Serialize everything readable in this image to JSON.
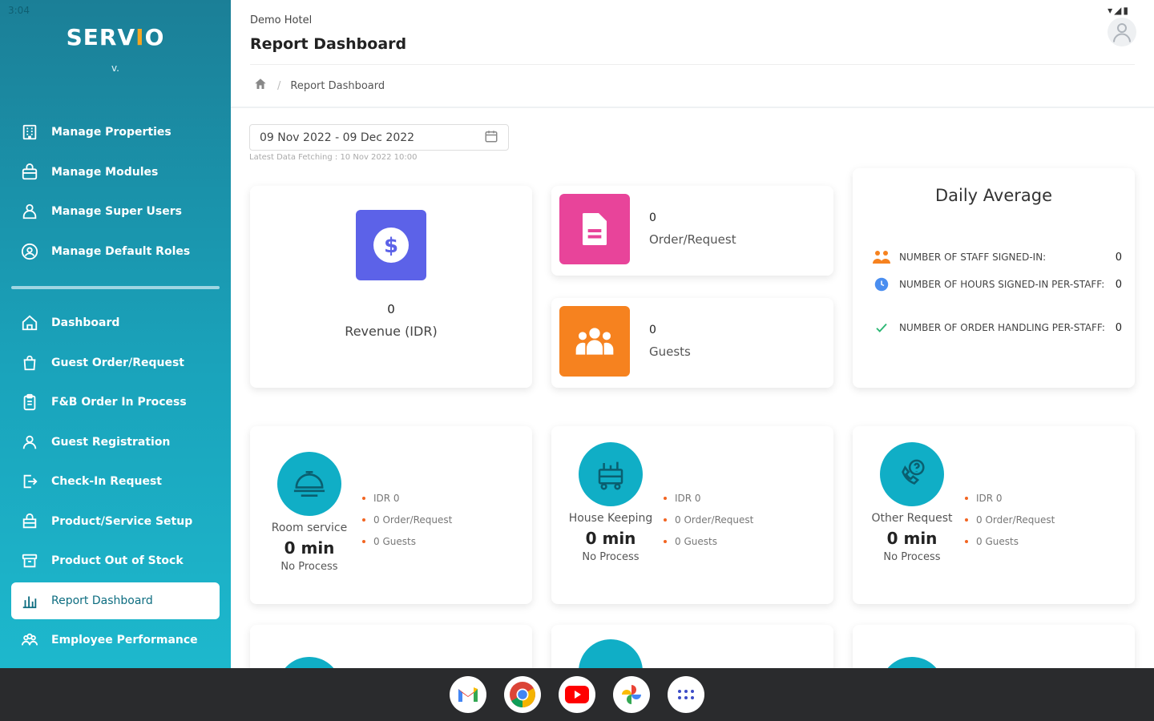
{
  "status": {
    "time": "3:04",
    "icons": "▾◢▮"
  },
  "sidebar": {
    "brand_pre": "SERV",
    "brand_accent": "I",
    "brand_post": "O",
    "brand_sub": "v.",
    "top_items": [
      {
        "label": "Manage Properties",
        "icon": "building-icon"
      },
      {
        "label": "Manage Modules",
        "icon": "briefcase-icon"
      },
      {
        "label": "Manage Super Users",
        "icon": "users-icon"
      },
      {
        "label": "Manage Default Roles",
        "icon": "role-icon"
      }
    ],
    "bottom_items": [
      {
        "label": "Dashboard",
        "icon": "home-icon"
      },
      {
        "label": "Guest Order/Request",
        "icon": "bag-icon"
      },
      {
        "label": "F&B Order In Process",
        "icon": "clipboard-icon"
      },
      {
        "label": "Guest Registration",
        "icon": "user-icon"
      },
      {
        "label": "Check-In Request",
        "icon": "checkin-icon"
      },
      {
        "label": "Product/Service Setup",
        "icon": "box-icon"
      },
      {
        "label": "Product Out of Stock",
        "icon": "archive-icon"
      },
      {
        "label": "Report Dashboard",
        "icon": "chart-icon",
        "active": true
      },
      {
        "label": "Employee Performance",
        "icon": "team-icon"
      }
    ]
  },
  "header": {
    "hotel": "Demo Hotel",
    "title": "Report Dashboard"
  },
  "breadcrumb": {
    "current": "Report Dashboard"
  },
  "filter": {
    "date_range": "09 Nov 2022 - 09 Dec 2022",
    "note": "Latest Data Fetching : 10 Nov 2022 10:00"
  },
  "revenue": {
    "value": "0",
    "label": "Revenue (IDR)"
  },
  "order": {
    "value": "0",
    "label": "Order/Request"
  },
  "guests": {
    "value": "0",
    "label": "Guests"
  },
  "daily_average": {
    "title": "Daily Average",
    "rows": [
      {
        "label": "NUMBER OF STAFF SIGNED-IN:",
        "value": "0"
      },
      {
        "label": "NUMBER OF HOURS SIGNED-IN PER-STAFF:",
        "value": "0"
      },
      {
        "label": "NUMBER OF ORDER HANDLING PER-STAFF:",
        "value": "0"
      }
    ]
  },
  "services": [
    {
      "name": "Room service",
      "minutes": "0 min",
      "status": "No Process",
      "idr": "IDR 0",
      "orders": "0 Order/Request",
      "guests": "0 Guests"
    },
    {
      "name": "House Keeping",
      "minutes": "0 min",
      "status": "No Process",
      "idr": "IDR 0",
      "orders": "0 Order/Request",
      "guests": "0 Guests"
    },
    {
      "name": "Other Request",
      "minutes": "0 min",
      "status": "No Process",
      "idr": "IDR 0",
      "orders": "0 Order/Request",
      "guests": "0 Guests"
    }
  ],
  "colors": {
    "sidebar_start": "#1b7f97",
    "sidebar_end": "#1db8cd",
    "revenue_icon": "#5c62e8",
    "order_icon": "#e8449a",
    "guest_icon": "#f6821f",
    "service_icon": "#10aec6",
    "bullet": "#f26522"
  },
  "taskbar": {
    "apps": [
      "gmail-icon",
      "chrome-icon",
      "youtube-icon",
      "photos-icon",
      "app-drawer-icon"
    ]
  }
}
